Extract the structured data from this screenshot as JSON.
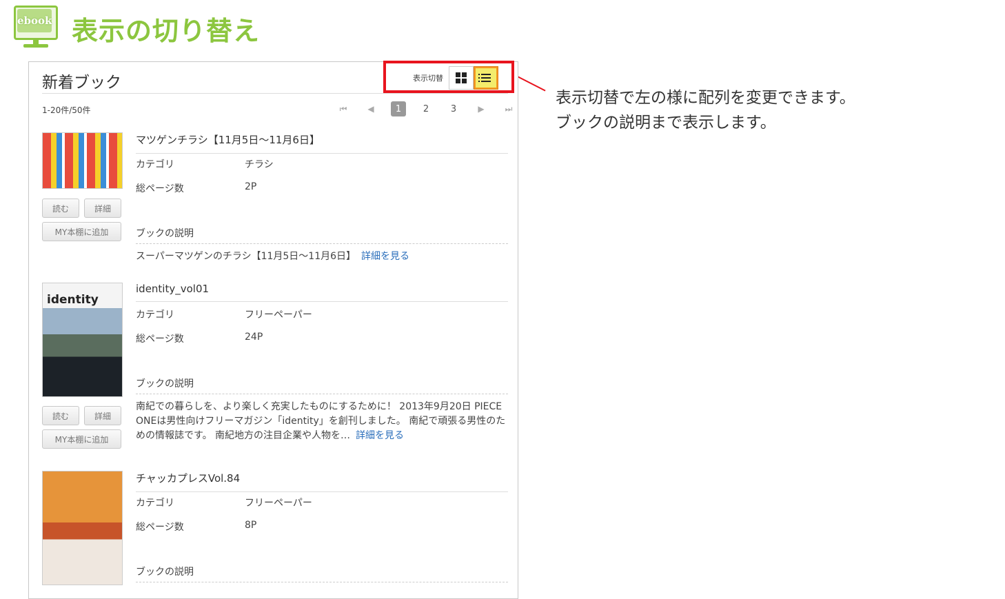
{
  "heading": {
    "logo_text": "ebook",
    "title": "表示の切り替え"
  },
  "panel": {
    "title": "新着ブック",
    "switch_label": "表示切替",
    "count": "1-20件/50件",
    "pager": {
      "first_glyph": "⏮",
      "prev_glyph": "◀",
      "pages": [
        "1",
        "2",
        "3"
      ],
      "current_page": "1",
      "next_glyph": "▶",
      "last_glyph": "⏭"
    }
  },
  "annotation": {
    "line1": "表示切替で左の様に配列を変更できます。",
    "line2": "ブックの説明まで表示します。"
  },
  "labels": {
    "category": "カテゴリ",
    "pages": "総ページ数",
    "description": "ブックの説明",
    "read": "読む",
    "detail": "詳細",
    "add_shelf": "MY本棚に追加",
    "see_more": "詳細を見る"
  },
  "books": [
    {
      "title": "マツゲンチラシ【11月5日〜11月6日】",
      "category": "チラシ",
      "pages": "2P",
      "description": "スーパーマツゲンのチラシ【11月5日〜11月6日】"
    },
    {
      "title": "identity_vol01",
      "cover_text": "identity",
      "category": "フリーペーパー",
      "pages": "24P",
      "description": "南紀での暮らしを、より楽しく充実したものにするために！ 2013年9月20日 PIECE ONEは男性向けフリーマガジン「identity」を創刊しました。 南紀で頑張る男性のための情報誌です。 南紀地方の注目企業や人物を…"
    },
    {
      "title": "チャッカプレスVol.84",
      "category": "フリーペーパー",
      "pages": "8P"
    }
  ],
  "colors": {
    "accent_green": "#8cc63f",
    "highlight_red": "#e8141e",
    "active_yellow": "#f3ec6c",
    "link_blue": "#2a6ebb"
  }
}
